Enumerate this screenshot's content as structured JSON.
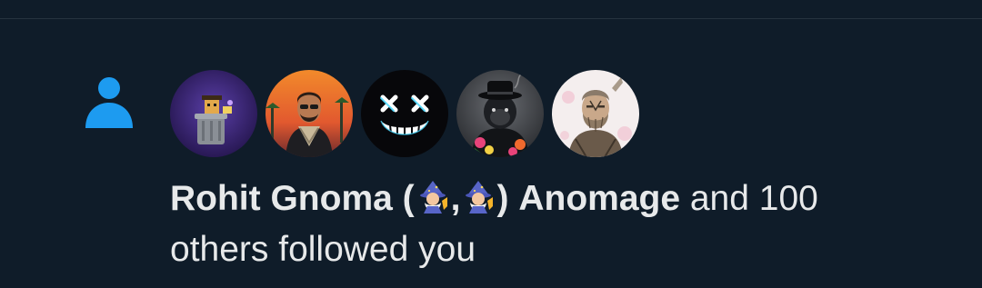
{
  "notification": {
    "actor_name_1": "Rohit Gnoma (",
    "actor_separator": ",",
    "actor_name_1_end": ")",
    "actor_name_2": "Anomage",
    "text_joiner": " and 100",
    "text_rest": "others followed you",
    "emoji_icon": "mage-emoji",
    "type_icon": "person-icon",
    "accent_color": "#1d9bf0"
  },
  "avatars": [
    {
      "icon": "trash-can-character-avatar"
    },
    {
      "icon": "man-in-scarf-avatar"
    },
    {
      "icon": "neon-smiley-avatar"
    },
    {
      "icon": "gorilla-in-hat-avatar"
    },
    {
      "icon": "bearded-warrior-avatar"
    }
  ]
}
